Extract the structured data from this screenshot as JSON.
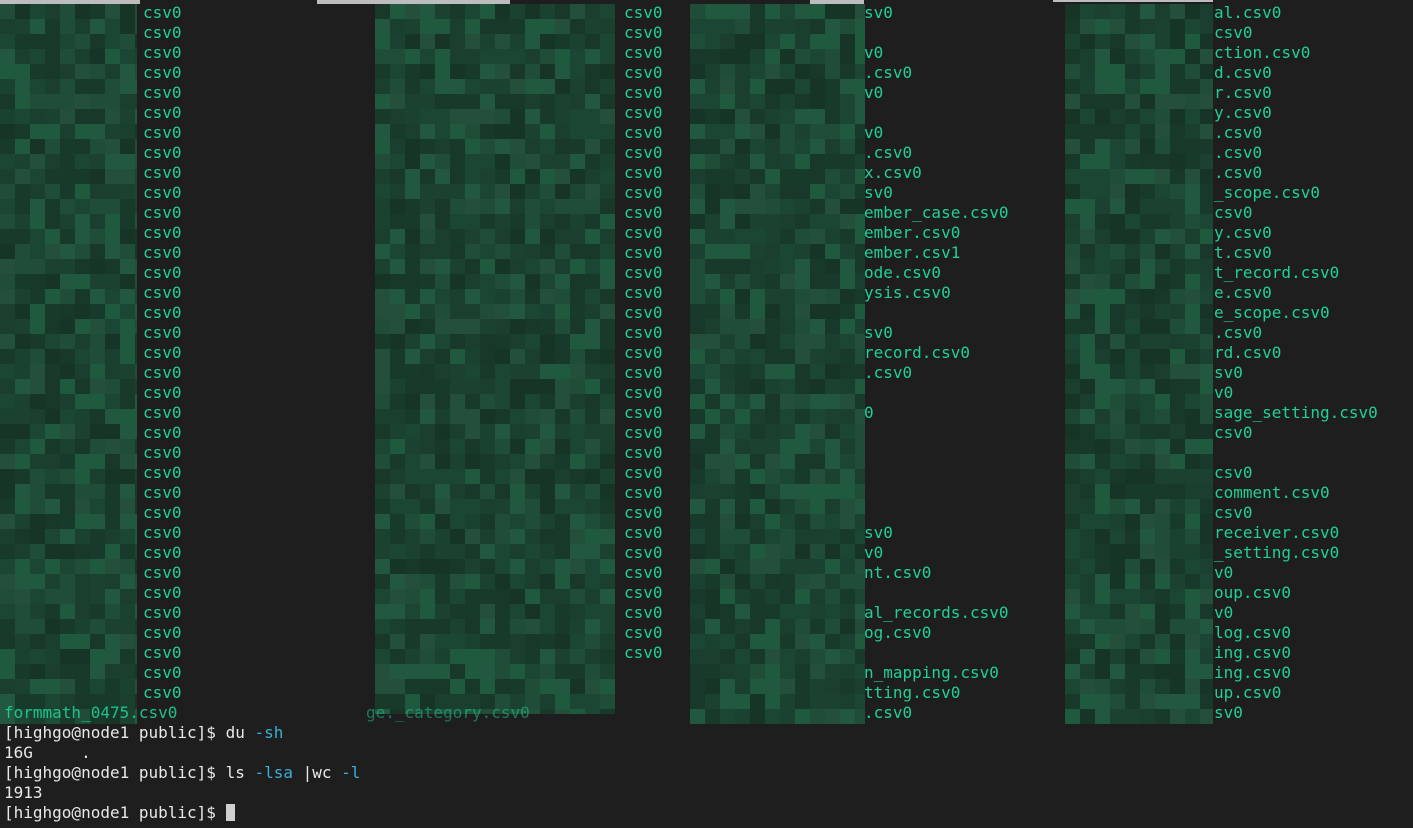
{
  "palette": {
    "background": "#1e1e1e",
    "filename": "#1ed294",
    "flag": "#3ab0d9",
    "prompt_text": "#e8e8e8",
    "cursor": "#cfcfcf"
  },
  "columns": [
    {
      "name": "col1",
      "entries": [
        "csv0",
        "csv0",
        "csv0",
        "csv0",
        "csv0",
        "csv0",
        "csv0",
        "csv0",
        "csv0",
        "csv0",
        "csv0",
        "csv0",
        "csv0",
        "csv0",
        "csv0",
        "csv0",
        "csv0",
        "csv0",
        "csv0",
        "csv0",
        "csv0",
        "csv0",
        "csv0",
        "csv0",
        "csv0",
        "csv0",
        "csv0",
        "csv0",
        "csv0",
        "csv0",
        "csv0",
        "csv0",
        "csv0",
        "csv0",
        "csv0"
      ]
    },
    {
      "name": "col2",
      "entries": [
        "csv0",
        "csv0",
        "csv0",
        "csv0",
        "csv0",
        "csv0",
        "csv0",
        "csv0",
        "csv0",
        "csv0",
        "csv0",
        "csv0",
        "csv0",
        "csv0",
        "csv0",
        "csv0",
        "csv0",
        "csv0",
        "csv0",
        "csv0",
        "csv0",
        "csv0",
        "csv0",
        "csv0",
        "csv0",
        "csv0",
        "csv0",
        "csv0",
        "csv0",
        "csv0",
        "csv0",
        "csv0",
        "csv0"
      ]
    },
    {
      "name": "col3",
      "entries": [
        "sv0",
        "",
        "v0",
        ".csv0",
        "v0",
        "",
        "v0",
        ".csv0",
        "x.csv0",
        "sv0",
        "ember_case.csv0",
        "ember.csv0",
        "ember.csv1",
        "ode.csv0",
        "ysis.csv0",
        "",
        "sv0",
        "record.csv0",
        ".csv0",
        "",
        "0",
        "",
        "",
        "",
        "",
        "",
        "sv0",
        "v0",
        "nt.csv0",
        "",
        "al_records.csv0",
        "og.csv0",
        "",
        "n_mapping.csv0",
        "tting.csv0",
        ".csv0"
      ]
    },
    {
      "name": "col4",
      "entries": [
        "al.csv0",
        "csv0",
        "ction.csv0",
        "d.csv0",
        "r.csv0",
        "y.csv0",
        ".csv0",
        ".csv0",
        ".csv0",
        "_scope.csv0",
        "csv0",
        "y.csv0",
        "t.csv0",
        "t_record.csv0",
        "e.csv0",
        "e_scope.csv0",
        ".csv0",
        "rd.csv0",
        "sv0",
        "v0",
        "sage_setting.csv0",
        "csv0",
        "",
        "csv0",
        "comment.csv0",
        "csv0",
        "receiver.csv0",
        "_setting.csv0",
        "v0",
        "oup.csv0",
        "v0",
        "log.csv0",
        "ing.csv0",
        "ing.csv0",
        "up.csv0",
        "sv0"
      ]
    }
  ],
  "overlap_row": {
    "col1_text": "formmath_0475.csv0",
    "col2_text": "ge._category.csv0"
  },
  "terminal": {
    "lines": [
      {
        "prompt": "[highgo@node1 public]$ ",
        "cmd": "du ",
        "flag": "-sh"
      },
      {
        "output": "16G     ."
      },
      {
        "prompt": "[highgo@node1 public]$ ",
        "cmd": "ls ",
        "flag": "-lsa",
        "rest": " |wc ",
        "flag2": "-l"
      },
      {
        "output": "1913"
      },
      {
        "prompt": "[highgo@node1 public]$ "
      }
    ]
  }
}
